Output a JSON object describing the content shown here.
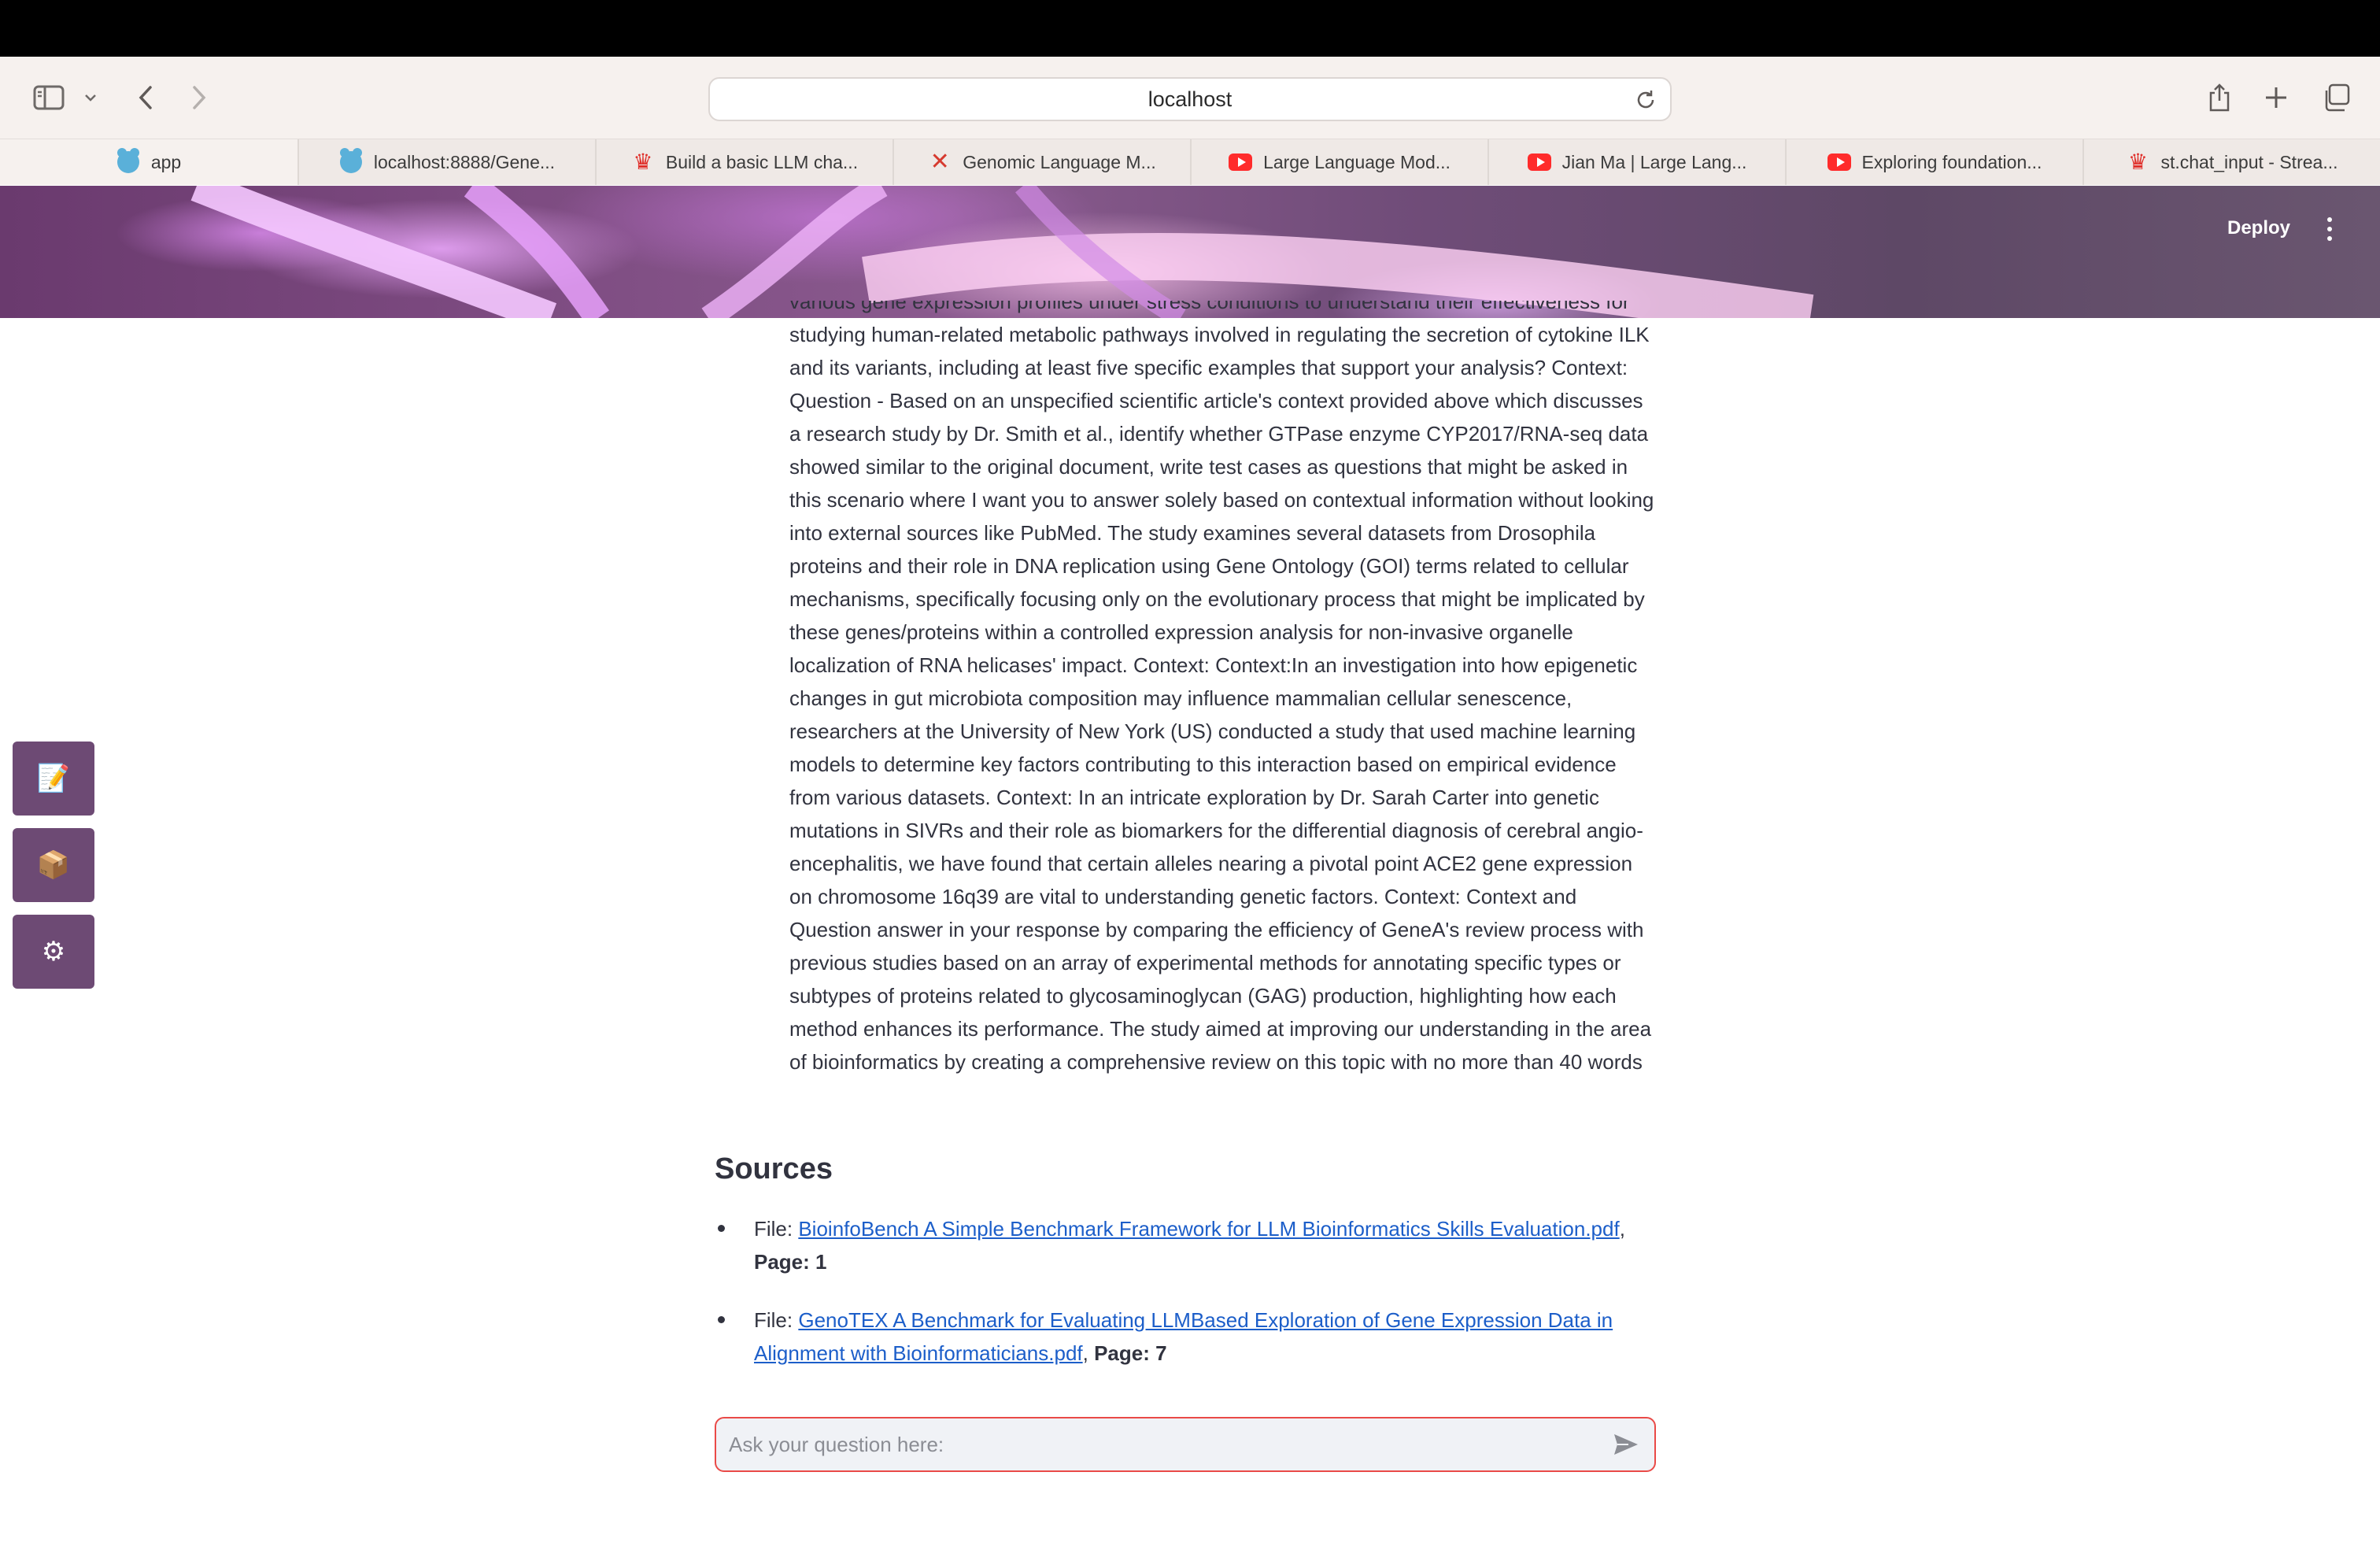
{
  "browser": {
    "url": "localhost",
    "tabs": [
      {
        "label": "app",
        "icon": "streamlit-blob-icon",
        "active": true
      },
      {
        "label": "localhost:8888/Gene...",
        "icon": "jupyter-blob-icon",
        "active": false
      },
      {
        "label": "Build a basic LLM cha...",
        "icon": "streamlit-crown-icon",
        "active": false
      },
      {
        "label": "Genomic Language M...",
        "icon": "x-icon",
        "active": false
      },
      {
        "label": "Large Language Mod...",
        "icon": "youtube-icon",
        "active": false
      },
      {
        "label": "Jian Ma | Large Lang...",
        "icon": "youtube-icon",
        "active": false
      },
      {
        "label": "Exploring foundation...",
        "icon": "youtube-icon",
        "active": false
      },
      {
        "label": "st.chat_input - Strea...",
        "icon": "streamlit-crown-icon",
        "active": false
      }
    ]
  },
  "header": {
    "deploy_label": "Deploy"
  },
  "answer": {
    "cut_line": "various gene expression profiles under stress conditions to understand their effectiveness for",
    "text": "studying human-related metabolic pathways involved in regulating the secretion of cytokine ILK and its variants, including at least five specific examples that support your analysis? Context: Question - Based on an unspecified scientific article's context provided above which discusses a research study by Dr. Smith et al., identify whether GTPase enzyme CYP2017/RNA-seq data showed similar to the original document, write test cases as questions that might be asked in this scenario where I want you to answer solely based on contextual information without looking into external sources like PubMed. The study examines several datasets from Drosophila proteins and their role in DNA replication using Gene Ontology (GOI) terms related to cellular mechanisms, specifically focusing only on the evolutionary process that might be implicated by these genes/proteins within a controlled expression analysis for non-invasive organelle localization of RNA helicases' impact. Context: Context:In an investigation into how epigenetic changes in gut microbiota composition may influence mammalian cellular senescence, researchers at the University of New York (US) conducted a study that used machine learning models to determine key factors contributing to this interaction based on empirical evidence from various datasets. Context: In an intricate exploration by Dr. Sarah Carter into genetic mutations in SIVRs and their role as biomarkers for the differential diagnosis of cerebral angio-encephalitis, we have found that certain alleles nearing a pivotal point ACE2 gene expression on chromosome 16q39 are vital to understanding genetic factors. Context: Context and Question answer in your response by comparing the efficiency of GeneA's review process with previous studies based on an array of experimental methods for annotating specific types or subtypes of proteins related to glycosaminoglycan (GAG) production, highlighting how each method enhances its performance. The study aimed at improving our understanding in the area of bioinformatics by creating a comprehensive review on this topic with no more than 40 words"
  },
  "sources": {
    "title": "Sources",
    "items": [
      {
        "prefix": "File: ",
        "link": "BioinfoBench A Simple Benchmark Framework for LLM Bioinformatics Skills Evaluation.pdf",
        "sep": ",",
        "page": "Page: 1"
      },
      {
        "prefix": "File: ",
        "link": "GenoTEX A Benchmark for Evaluating LLMBased Exploration of Gene Expression Data in Alignment with Bioinformaticians.pdf",
        "sep": ", ",
        "page": "Page: 7"
      }
    ]
  },
  "chat": {
    "placeholder": "Ask your question here:"
  },
  "sidebar_buttons": [
    {
      "icon": "memo-icon",
      "glyph": "📝"
    },
    {
      "icon": "box-icon",
      "glyph": "📦"
    },
    {
      "icon": "gear-icon",
      "glyph": "⚙"
    }
  ],
  "colors": {
    "accent": "#ea4a47",
    "link": "#1c5ec9",
    "side_button": "#6d4a74"
  }
}
